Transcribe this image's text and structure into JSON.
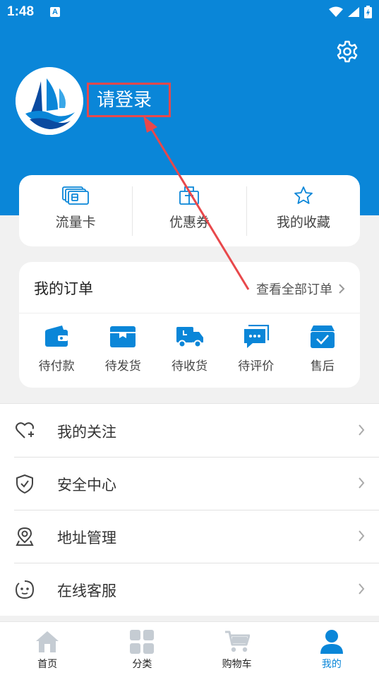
{
  "status_bar": {
    "time": "1:48",
    "notification_glyph": "A"
  },
  "header": {
    "login_text": "请登录",
    "accent": "#0a86d8"
  },
  "quick_links": [
    {
      "label": "流量卡",
      "icon": "sim-card-icon"
    },
    {
      "label": "优惠券",
      "icon": "coupon-icon"
    },
    {
      "label": "我的收藏",
      "icon": "star-icon"
    }
  ],
  "orders": {
    "title": "我的订单",
    "view_all": "查看全部订单",
    "items": [
      {
        "label": "待付款",
        "icon": "wallet-icon"
      },
      {
        "label": "待发货",
        "icon": "box-icon"
      },
      {
        "label": "待收货",
        "icon": "truck-icon"
      },
      {
        "label": "待评价",
        "icon": "comment-icon"
      },
      {
        "label": "售后",
        "icon": "after-sales-icon"
      }
    ]
  },
  "menu": [
    {
      "label": "我的关注",
      "icon": "heart-plus-icon"
    },
    {
      "label": "安全中心",
      "icon": "shield-check-icon"
    },
    {
      "label": "地址管理",
      "icon": "location-pin-icon"
    },
    {
      "label": "在线客服",
      "icon": "chat-face-icon"
    }
  ],
  "tabs": [
    {
      "label": "首页",
      "icon": "home-icon",
      "active": false
    },
    {
      "label": "分类",
      "icon": "grid-icon",
      "active": false
    },
    {
      "label": "购物车",
      "icon": "cart-icon",
      "active": false
    },
    {
      "label": "我的",
      "icon": "user-icon",
      "active": true
    }
  ],
  "colors": {
    "primary": "#0a86d8",
    "highlight": "#e8484b",
    "inactive_icon": "#c5ccd3"
  }
}
